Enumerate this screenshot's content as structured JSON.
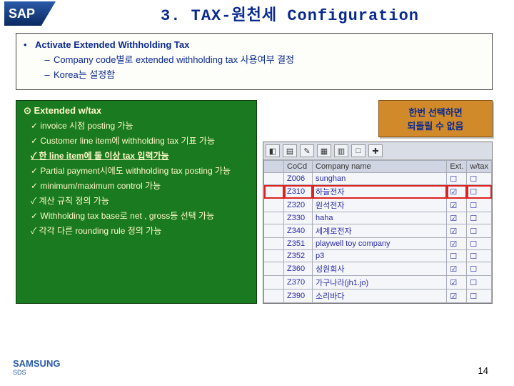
{
  "header": {
    "sap_label": "SAP",
    "title": "3. TAX-원천세 Configuration"
  },
  "section": {
    "title": "Activate Extended Withholding Tax",
    "items": [
      "Company code별로 extended withholding tax 사용여부 결정",
      "Korea는 설정함"
    ]
  },
  "green": {
    "heading": "⊙ Extended w/tax",
    "features": [
      {
        "text": "invoice 시점 posting 가능",
        "u": false
      },
      {
        "text": "Customer line item에 withholding tax 기표 가능",
        "u": false
      },
      {
        "text": "한 line item에 둘 이상 tax 입력가능",
        "u": true
      },
      {
        "text": "Partial payment시에도 withholding tax posting 가능",
        "u": false
      },
      {
        "text": "minimum/maximum control 가능",
        "u": false
      },
      {
        "text": "계산 규칙 정의 가능",
        "u": false
      },
      {
        "text": "Withholding tax base로 net , gross등 선택 가능",
        "u": false
      },
      {
        "text": "각각 다른 rounding rule 정의 가능",
        "u": false
      }
    ]
  },
  "callout": {
    "line1": "한번 선택하면",
    "line2": "되돌릴 수 없음"
  },
  "grid": {
    "headers": {
      "sel": "",
      "cocd": "CoCd",
      "name": "Company name",
      "ext": "Ext.",
      "wtax": "w/tax"
    },
    "rows": [
      {
        "cocd": "Z006",
        "name": "sunghan",
        "ext": false,
        "wtax": false,
        "hl": false
      },
      {
        "cocd": "Z310",
        "name": "하늘전자",
        "ext": true,
        "wtax": false,
        "hl": true
      },
      {
        "cocd": "Z320",
        "name": "원석전자",
        "ext": true,
        "wtax": false,
        "hl": false
      },
      {
        "cocd": "Z330",
        "name": "haha",
        "ext": true,
        "wtax": false,
        "hl": false
      },
      {
        "cocd": "Z340",
        "name": "세계로전자",
        "ext": true,
        "wtax": false,
        "hl": false
      },
      {
        "cocd": "Z351",
        "name": "playwell toy company",
        "ext": true,
        "wtax": false,
        "hl": false
      },
      {
        "cocd": "Z352",
        "name": "p3",
        "ext": false,
        "wtax": false,
        "hl": false
      },
      {
        "cocd": "Z360",
        "name": "성원회사",
        "ext": true,
        "wtax": false,
        "hl": false
      },
      {
        "cocd": "Z370",
        "name": "가구나라(jh1.jo)",
        "ext": true,
        "wtax": false,
        "hl": false
      },
      {
        "cocd": "Z390",
        "name": "소리바다",
        "ext": true,
        "wtax": false,
        "hl": false
      }
    ]
  },
  "toolbar_icons": [
    "◧",
    "▤",
    "✎",
    "▦",
    "▥",
    "□",
    "✚"
  ],
  "footer": {
    "brand_top": "SAMSUNG",
    "brand_sub": "SDS",
    "page": "14"
  }
}
